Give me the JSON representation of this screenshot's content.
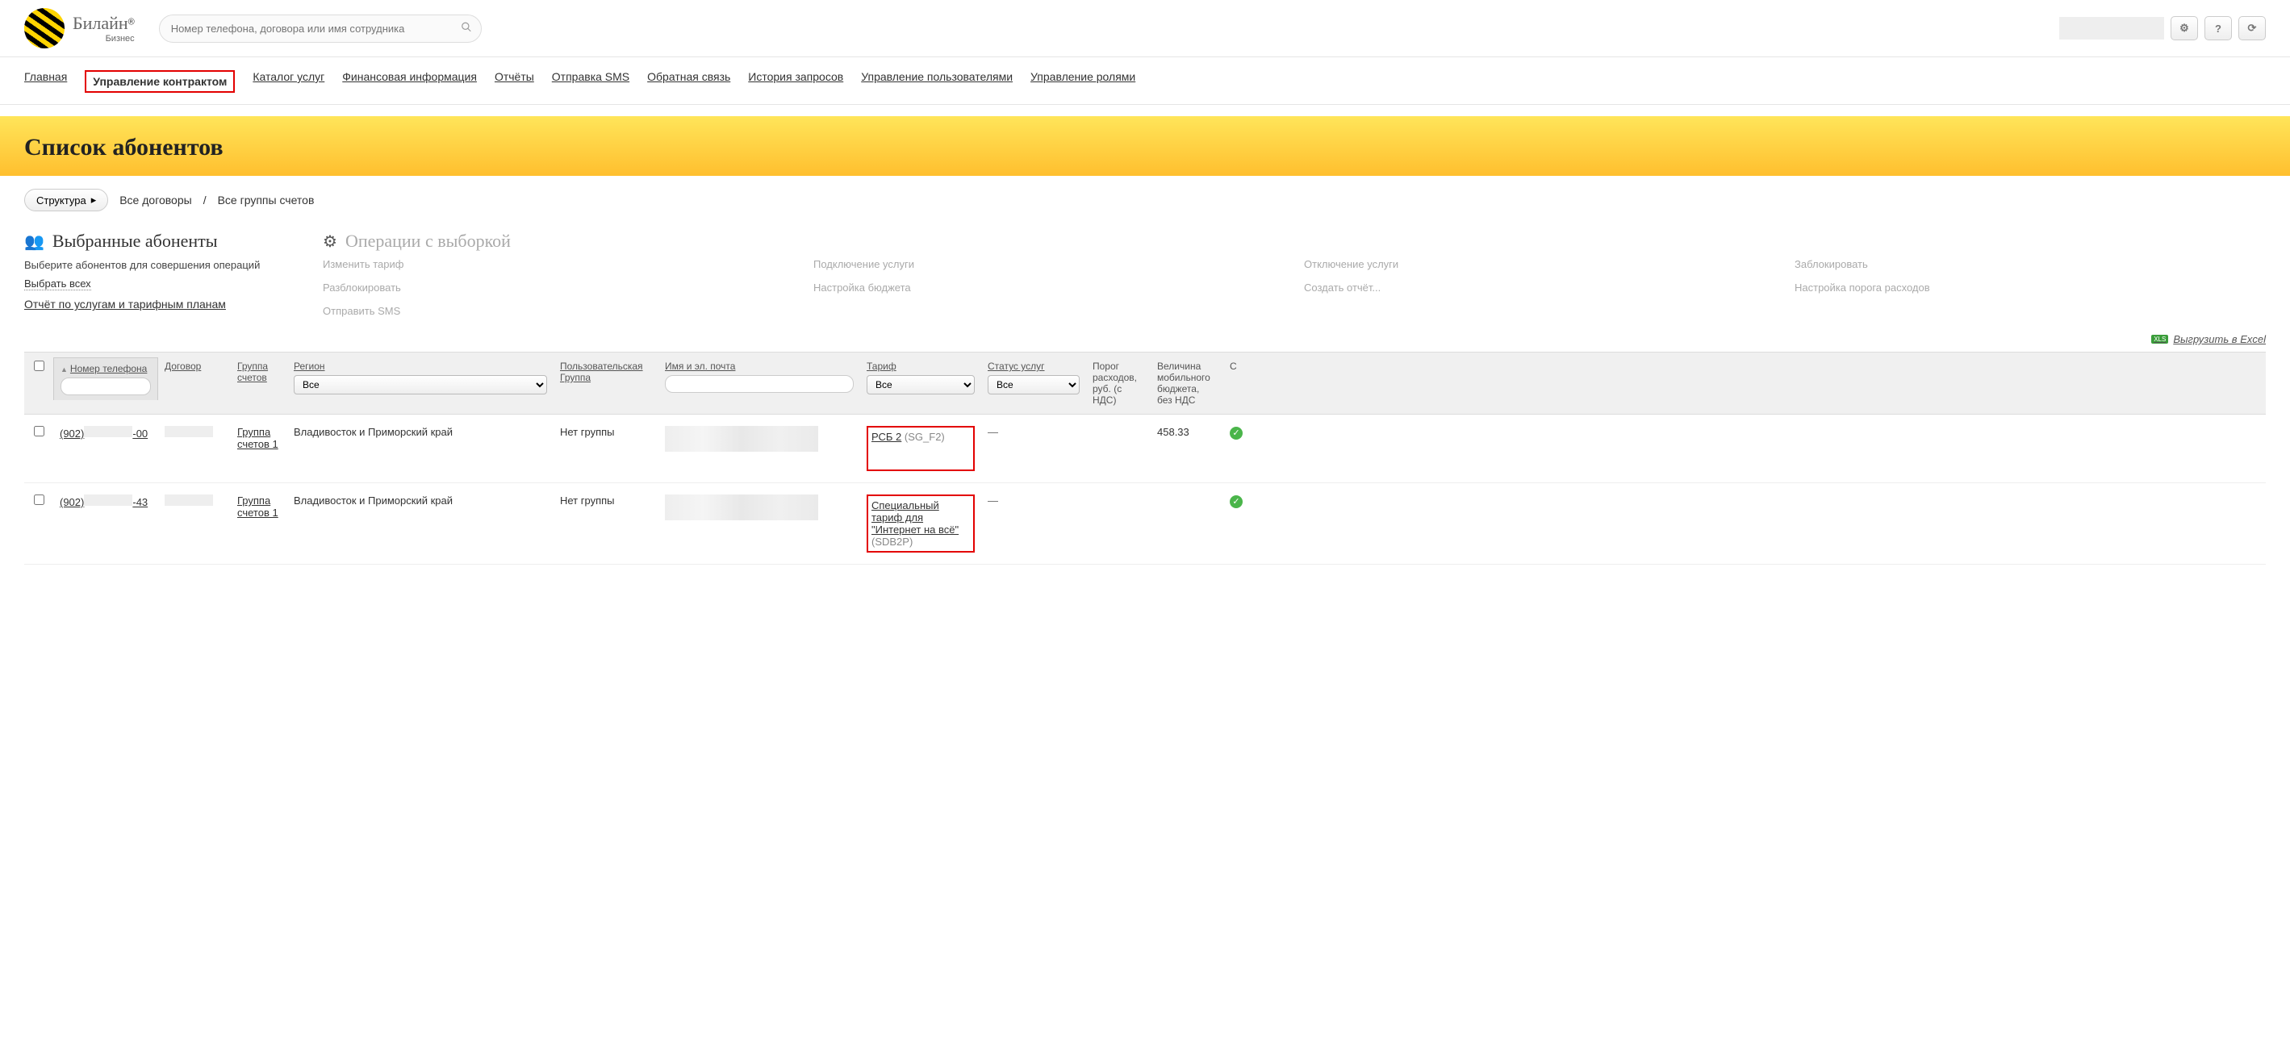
{
  "header": {
    "logo_text": "Билайн",
    "logo_sub": "Бизнес",
    "logo_mark": "®",
    "search_placeholder": "Номер телефона, договора или имя сотрудника"
  },
  "nav": {
    "items": [
      "Главная",
      "Управление контрактом",
      "Каталог услуг",
      "Финансовая информация",
      "Отчёты",
      "Отправка SMS",
      "Обратная связь",
      "История запросов",
      "Управление пользователями",
      "Управление ролями"
    ],
    "active_index": 1
  },
  "page_title": "Список абонентов",
  "breadcrumb": {
    "struct_btn": "Структура",
    "path": [
      "Все договоры",
      "Все группы счетов"
    ]
  },
  "selected_panel": {
    "title": "Выбранные абоненты",
    "hint": "Выберите абонентов для совершения операций",
    "select_all": "Выбрать всех",
    "report_link": "Отчёт по услугам и тарифным планам"
  },
  "ops_panel": {
    "title": "Операции с выборкой",
    "items": [
      "Изменить тариф",
      "Подключение услуги",
      "Отключение услуги",
      "Заблокировать",
      "Разблокировать",
      "Настройка бюджета",
      "Создать отчёт...",
      "Настройка порога расходов",
      "Отправить SMS"
    ]
  },
  "export_label": "Выгрузить в Excel",
  "table": {
    "headers": {
      "phone": "Номер телефона",
      "contract": "Договор",
      "group": "Группа счетов",
      "region": "Регион",
      "usergroup": "Пользовательская Группа",
      "name": "Имя и эл. почта",
      "tariff": "Тариф",
      "status": "Статус услуг",
      "limit": "Порог расходов, руб. (с НДС)",
      "budget": "Величина мобильного бюджета, без НДС",
      "st": "С"
    },
    "region_filter": "Все",
    "tariff_filter": "Все",
    "status_filter": "Все",
    "rows": [
      {
        "phone_prefix": "(902)",
        "phone_suffix": "-00",
        "group": "Группа счетов 1",
        "region": "Владивосток и Приморский край",
        "usergroup": "Нет группы",
        "tariff_name": "РСБ 2",
        "tariff_code": "(SG_F2)",
        "status": "—",
        "limit": "",
        "budget": "458.33"
      },
      {
        "phone_prefix": "(902)",
        "phone_suffix": "-43",
        "group": "Группа счетов 1",
        "region": "Владивосток и Приморский край",
        "usergroup": "Нет группы",
        "tariff_name": "Специальный тариф для \"Интернет на всё\"",
        "tariff_code": "(SDB2P)",
        "status": "—",
        "limit": "",
        "budget": ""
      }
    ]
  }
}
